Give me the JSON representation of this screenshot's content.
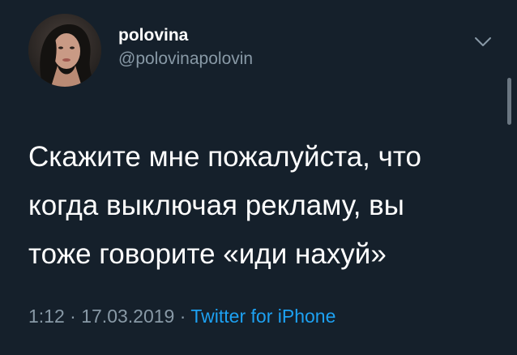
{
  "author": {
    "display_name": "polovina",
    "handle": "@polovinapolovin",
    "avatar_icon": "profile-photo"
  },
  "tweet": {
    "lines": [
      "Скажите мне пожалуйста, что",
      "когда выключая рекламу, вы",
      "тоже говорите «иди нахуй»"
    ]
  },
  "meta": {
    "time": "1:12",
    "separator": "·",
    "date": "17.03.2019",
    "source": "Twitter for iPhone"
  },
  "icons": {
    "menu": "chevron-down-icon"
  },
  "colors": {
    "background": "#15202b",
    "text": "#ffffff",
    "secondary": "#8899a6",
    "link": "#1da1f2"
  }
}
